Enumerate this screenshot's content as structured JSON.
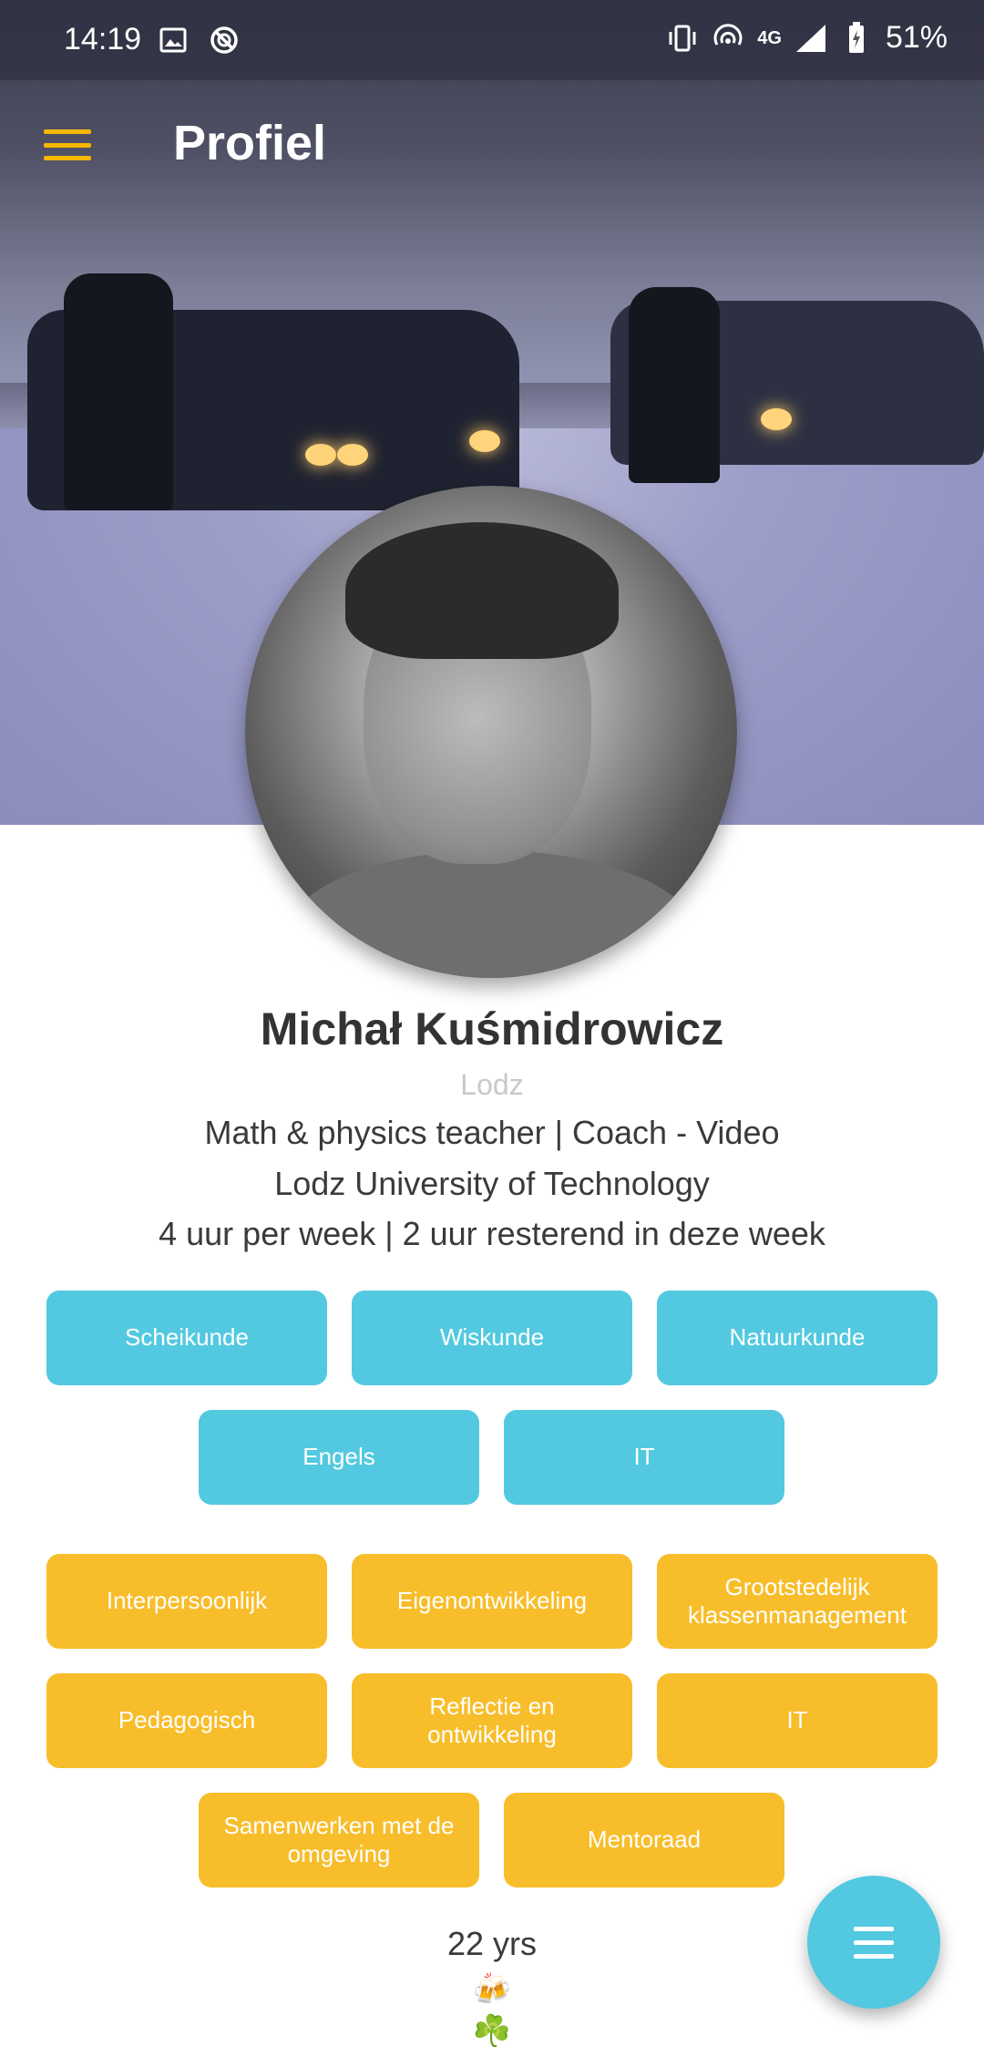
{
  "status_bar": {
    "time": "14:19",
    "network_label": "4G",
    "battery_percent": "51%",
    "icons": [
      "image-icon",
      "sync-off-icon",
      "vibrate-icon",
      "hotspot-icon",
      "signal-icon",
      "battery-charging-icon"
    ]
  },
  "app_bar": {
    "title": "Profiel",
    "menu_icon": "hamburger-menu-icon"
  },
  "profile": {
    "name": "Michał Kuśmidrowicz",
    "city": "Lodz",
    "headline": "Math & physics teacher | Coach - Video",
    "institution": "Lodz University of Technology",
    "availability": "4 uur per week | 2 uur resterend in deze week",
    "age": "22  yrs",
    "emojis": [
      "🍻",
      "☘️",
      "🌙"
    ]
  },
  "subjects": [
    "Scheikunde",
    "Wiskunde",
    "Natuurkunde",
    "Engels",
    "IT"
  ],
  "competencies": [
    "Interpersoonlijk",
    "Eigenontwikkeling",
    "Grootstedelijk klassenmanagement",
    "Pedagogisch",
    "Reflectie en ontwikkeling",
    "IT",
    "Samenwerken met de omgeving",
    "Mentoraad"
  ],
  "colors": {
    "accent_yellow": "#f8bd2a",
    "accent_blue": "#52c9e0",
    "menu_icon": "#f5b700"
  },
  "fab": {
    "icon": "menu-icon"
  }
}
